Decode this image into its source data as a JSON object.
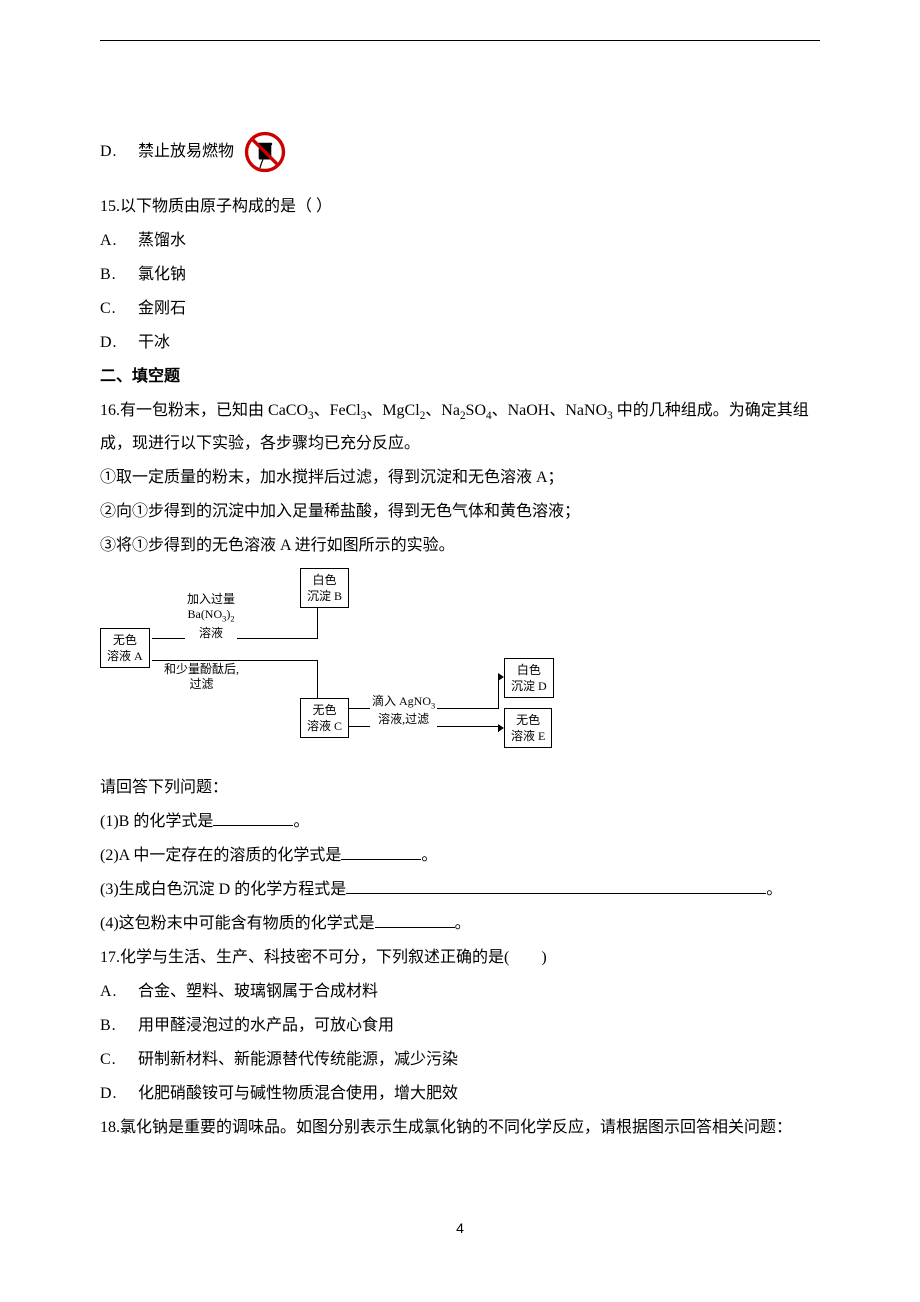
{
  "optionD14": {
    "label": "D.",
    "text": "禁止放易燃物",
    "icon": "prohibit-barrel-icon"
  },
  "q15": {
    "number": "15.",
    "stem": "以下物质由原子构成的是（ ）",
    "options": [
      {
        "label": "A.",
        "text": "蒸馏水"
      },
      {
        "label": "B.",
        "text": "氯化钠"
      },
      {
        "label": "C.",
        "text": "金刚石"
      },
      {
        "label": "D.",
        "text": "干冰"
      }
    ]
  },
  "section2": "二、填空题",
  "q16": {
    "number": "16.",
    "stem_pre": "有一包粉末，已知由 ",
    "formulas": "CaCO₃、FeCl₃、MgCl₂、Na₂SO₄、NaOH、NaNO₃",
    "stem_post": " 中的几种组成。为确定其组成，现进行以下实验，各步骤均已充分反应。",
    "step1": "①取一定质量的粉末，加水搅拌后过滤，得到沉淀和无色溶液 A；",
    "step2": "②向①步得到的沉淀中加入足量稀盐酸，得到无色气体和黄色溶液；",
    "step3": "③将①步得到的无色溶液 A 进行如图所示的实验。",
    "prompt": "请回答下列问题：",
    "p1_pre": "(1)B 的化学式是",
    "p1_post": "。",
    "p2_pre": "(2)A 中一定存在的溶质的化学式是",
    "p2_post": "。",
    "p3_pre": "(3)生成白色沉淀 D 的化学方程式是",
    "p3_post": "。",
    "p4_pre": "(4)这包粉末中可能含有物质的化学式是",
    "p4_post": "。",
    "diagram": {
      "boxA": "无色\n溶液 A",
      "label_over_1_line1": "加入过量",
      "label_over_1_line2": "Ba(NO₃)₂",
      "label_over_1_line3": "溶液",
      "label_under_1_line1": "和少量酚酞后,",
      "label_under_1_line2": "过滤",
      "boxB": "白色\n沉淀 B",
      "boxC": "无色\n溶液 C",
      "label_over_2_line1": "滴入 AgNO₃",
      "label_over_2_line2": "溶液,过滤",
      "boxD": "白色\n沉淀 D",
      "boxE": "无色\n溶液 E"
    }
  },
  "q17": {
    "number": "17.",
    "stem": "化学与生活、生产、科技密不可分，下列叙述正确的是(　　)",
    "options": [
      {
        "label": "A.",
        "text": "合金、塑料、玻璃钢属于合成材料"
      },
      {
        "label": "B.",
        "text": "用甲醛浸泡过的水产品，可放心食用"
      },
      {
        "label": "C.",
        "text": "研制新材料、新能源替代传统能源，减少污染"
      },
      {
        "label": "D.",
        "text": "化肥硝酸铵可与碱性物质混合使用，增大肥效"
      }
    ]
  },
  "q18": {
    "number": "18.",
    "stem": "氯化钠是重要的调味品。如图分别表示生成氯化钠的不同化学反应，请根据图示回答相关问题："
  },
  "pageNumber": "4"
}
